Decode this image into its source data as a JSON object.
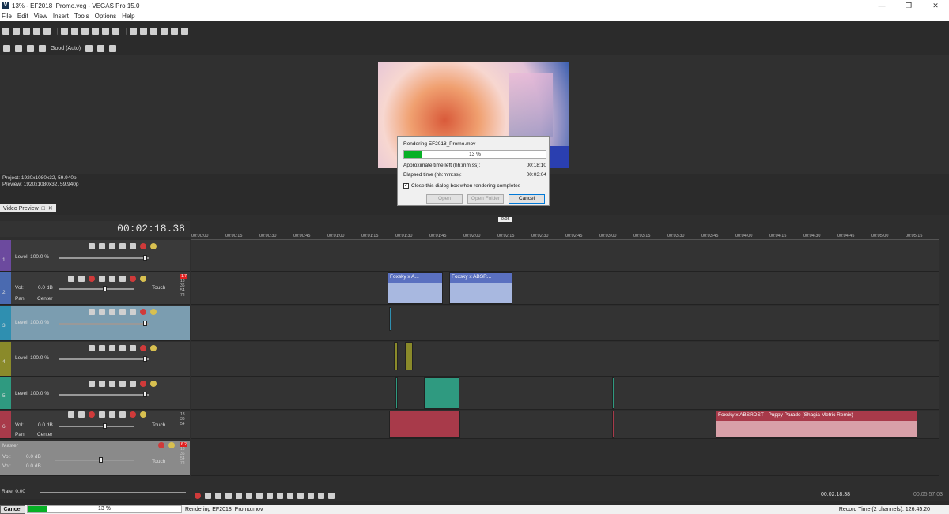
{
  "window": {
    "title": "13% - EF2018_Promo.veg - VEGAS Pro 15.0",
    "app_icon": "V"
  },
  "menu": [
    "File",
    "Edit",
    "View",
    "Insert",
    "Tools",
    "Options",
    "Help"
  ],
  "preview_toolbar": {
    "quality": "Good (Auto)"
  },
  "preview_info": {
    "project": "Project:  1920x1080x32, 59.940p",
    "preview": "Preview: 1920x1080x32, 59.940p",
    "tab": "Video Preview"
  },
  "render_dialog": {
    "title": "Rendering EF2018_Promo.mov",
    "percent": "13 %",
    "progress": 0.13,
    "time_left_label": "Approximate time left (hh:mm:ss):",
    "time_left": "00:18:10",
    "elapsed_label": "Elapsed time (hh:mm:ss):",
    "elapsed": "00:03:04",
    "close_checkbox": "Close this dialog box when rendering completes",
    "open_btn": "Open",
    "open_folder_btn": "Open Folder",
    "cancel_btn": "Cancel"
  },
  "timeline": {
    "timecode": "00:02:18.38",
    "cursor_marker": "-0:05",
    "ruler": [
      "00:00:00",
      "00:00:15",
      "00:00:30",
      "00:00:45",
      "00:01:00",
      "00:01:15",
      "00:01:30",
      "00:01:45",
      "00:02:00",
      "00:02:15",
      "00:02:30",
      "00:02:45",
      "00:03:00",
      "00:03:15",
      "00:03:30",
      "00:03:45",
      "00:04:00",
      "00:04:15",
      "00:04:30",
      "00:04:45",
      "00:05:00",
      "00:05:15"
    ]
  },
  "tracks": [
    {
      "num": "1",
      "level": "Level: 100.0 %"
    },
    {
      "num": "2",
      "vol_label": "Vol:",
      "vol": "0.0 dB",
      "pan_label": "Pan:",
      "pan": "Center",
      "mode": "Touch",
      "peak": "1.7"
    },
    {
      "num": "3",
      "level": "Level: 100.0 %"
    },
    {
      "num": "4",
      "level": "Level: 100.0 %"
    },
    {
      "num": "5",
      "level": "Level: 100.0 %"
    },
    {
      "num": "6",
      "vol_label": "Vol:",
      "vol": "0.0 dB",
      "pan_label": "Pan:",
      "pan": "Center",
      "mode": "Touch"
    }
  ],
  "meter_ticks": [
    "18",
    "36",
    "54",
    "72"
  ],
  "master": {
    "label": "Master",
    "vol_label": "Vol:",
    "vol1": "0.0 dB",
    "vol2": "0.0 dB",
    "mode": "Touch",
    "peak": "6.2"
  },
  "clips": {
    "a": "Foxsky x A...",
    "b": "Foxsky x ABSR...",
    "c": "Foxsky x ABSRDST - Puppy Parade (Shagia Metric Remix)"
  },
  "rate": "Rate: 0.00",
  "transport": {
    "time": "00:02:18.38",
    "end_time": "00:05:57.03"
  },
  "status": {
    "cancel": "Cancel",
    "percent": "13 %",
    "progress": 0.13,
    "message": "Rendering EF2018_Promo.mov",
    "record_time": "Record Time (2 channels): 126:45:20"
  },
  "colors": {
    "track1": "#6c4a9e",
    "track2": "#4a6ab0",
    "track3": "#2f8fb0",
    "track4": "#8a8a2a",
    "track5": "#2f9a80",
    "track6": "#a83a4a",
    "progress": "#06b025"
  }
}
